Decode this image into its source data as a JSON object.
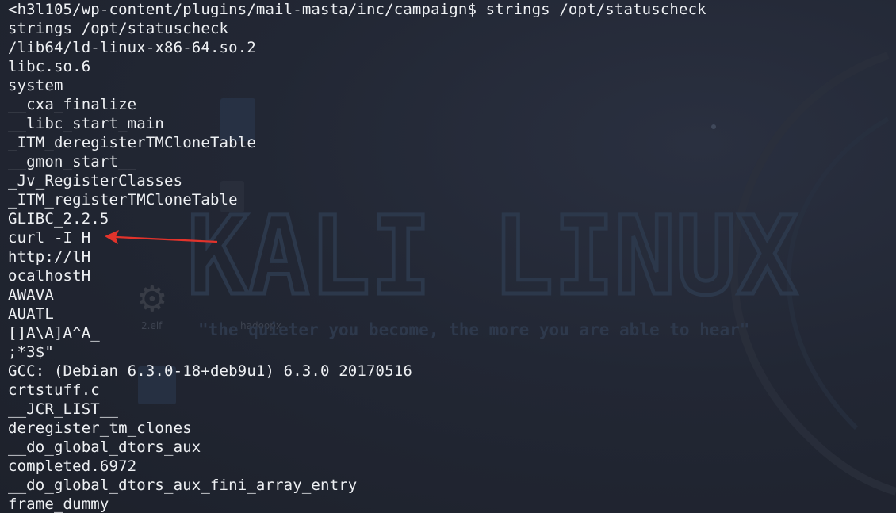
{
  "terminal": {
    "prompt_line": "<h3l105/wp-content/plugins/mail-masta/inc/campaign$ strings /opt/statuscheck",
    "output_lines": [
      "strings /opt/statuscheck",
      "/lib64/ld-linux-x86-64.so.2",
      "libc.so.6",
      "system",
      "__cxa_finalize",
      "__libc_start_main",
      "_ITM_deregisterTMCloneTable",
      "__gmon_start__",
      "_Jv_RegisterClasses",
      "_ITM_registerTMCloneTable",
      "GLIBC_2.2.5",
      "curl -I H",
      "http://lH",
      "ocalhostH",
      "AWAVA",
      "AUATL",
      "[]A\\A]A^A_",
      ";*3$\"",
      "GCC: (Debian 6.3.0-18+deb9u1) 6.3.0 20170516",
      "crtstuff.c",
      "__JCR_LIST__",
      "deregister_tm_clones",
      "__do_global_dtors_aux",
      "completed.6972",
      "__do_global_dtors_aux_fini_array_entry",
      "frame_dummy"
    ]
  },
  "wallpaper": {
    "logo_text": "KALI LINUX",
    "tagline": "\"the quieter you become, the more you are able to hear\"",
    "ghost_labels": [
      "2.elf",
      "hadoopx"
    ]
  },
  "annotation": {
    "arrow_color": "#e2332b",
    "target_line": "curl -I H"
  }
}
